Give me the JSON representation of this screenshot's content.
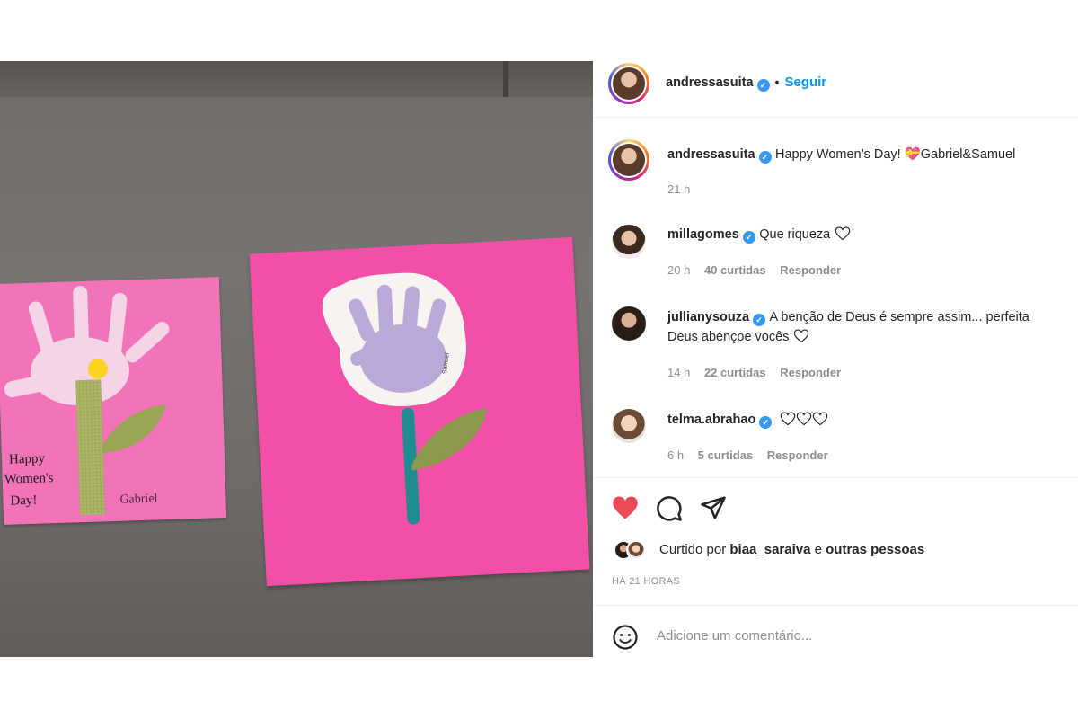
{
  "post": {
    "author": "andressasuita",
    "follow_label": "Seguir",
    "caption": "Happy Women’s Day! 💝Gabriel&Samuel",
    "caption_time": "21 h"
  },
  "comments": [
    {
      "user": "millagomes",
      "text": "Que riqueza",
      "time": "20 h",
      "likes": "40 curtidas",
      "reply": "Responder"
    },
    {
      "user": "jullianysouza",
      "text": "A benção de Deus é sempre assim... perfeita",
      "text2": "Deus abençoe vocês",
      "time": "14 h",
      "likes": "22 curtidas",
      "reply": "Responder"
    },
    {
      "user": "telma.abrahao",
      "text": "",
      "time": "6 h",
      "likes": "5 curtidas",
      "reply": "Responder"
    }
  ],
  "likes": {
    "prefix": "Curtido por ",
    "user": "biaa_saraiva",
    "connector": " e ",
    "suffix": "outras pessoas"
  },
  "posted": "HÁ 21 HORAS",
  "comment_box": {
    "placeholder": "Adicione um comentário..."
  },
  "photo_text": {
    "card1_greeting": [
      "Happy",
      "Women's",
      "Day!"
    ],
    "card1_name": "Gabriel",
    "card2_name": "Samuel"
  },
  "colors": {
    "like_red": "#ed4956",
    "link_blue": "#0095f6",
    "verified_blue": "#3897f0"
  }
}
